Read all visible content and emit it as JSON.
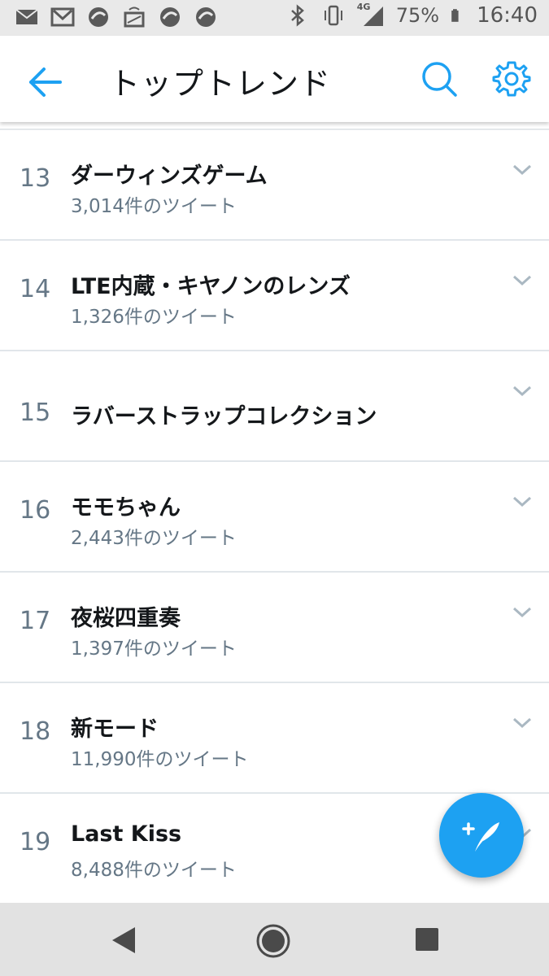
{
  "status_bar": {
    "battery": "75%",
    "time": "16:40",
    "network": "4G"
  },
  "header": {
    "title": "トップトレンド"
  },
  "trends": [
    {
      "rank": "13",
      "name": "ダーウィンズゲーム",
      "count": "3,014件のツイート"
    },
    {
      "rank": "14",
      "name": "LTE内蔵・キヤノンのレンズ",
      "count": "1,326件のツイート"
    },
    {
      "rank": "15",
      "name": "ラバーストラップコレクション",
      "count": ""
    },
    {
      "rank": "16",
      "name": "モモちゃん",
      "count": "2,443件のツイート"
    },
    {
      "rank": "17",
      "name": "夜桜四重奏",
      "count": "1,397件のツイート"
    },
    {
      "rank": "18",
      "name": "新モード",
      "count": "11,990件のツイート"
    },
    {
      "rank": "19",
      "name": "Last Kiss",
      "count": "8,488件のツイート"
    }
  ],
  "colors": {
    "accent": "#1da1f2",
    "text_primary": "#14171a",
    "text_secondary": "#657786"
  },
  "icons": {
    "back": "arrow-left-icon",
    "search": "search-icon",
    "settings": "gear-icon",
    "compose": "compose-tweet-icon",
    "chevron": "chevron-down-icon"
  }
}
